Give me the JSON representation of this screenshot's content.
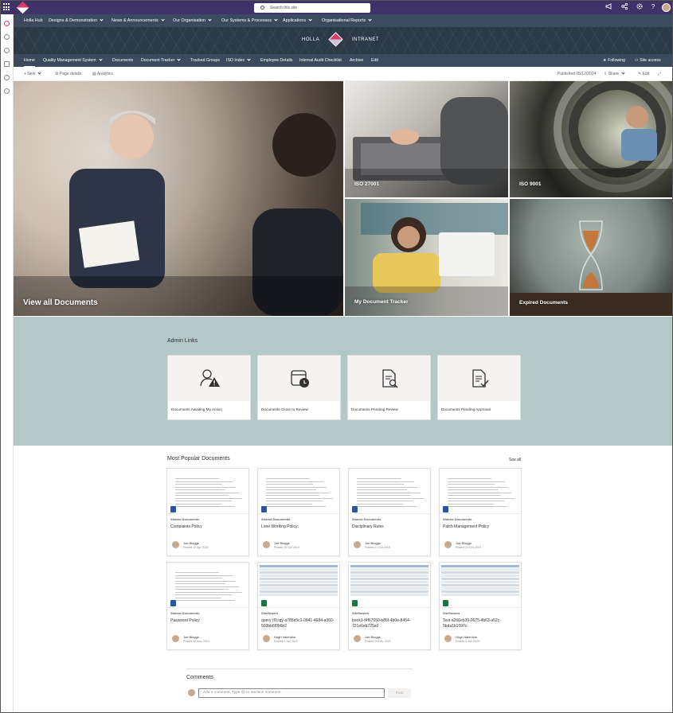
{
  "suite_bar": {
    "search_placeholder": "Search this site",
    "icons": [
      "waffle-icon",
      "megaphone-icon",
      "share-icon",
      "gear-icon",
      "help-icon"
    ]
  },
  "hub_nav": {
    "items": [
      {
        "label": "Holla Hub",
        "dropdown": false
      },
      {
        "label": "Designs & Demonstration",
        "dropdown": true
      },
      {
        "label": "News & Announcements",
        "dropdown": true
      },
      {
        "label": "Our Organisation",
        "dropdown": true
      },
      {
        "label": "Our Systems & Processes",
        "dropdown": true
      },
      {
        "label": "Applications",
        "dropdown": true
      },
      {
        "label": "Organisational Reports",
        "dropdown": true
      }
    ]
  },
  "brand": {
    "left": "HOLLA",
    "right": "INTRANET"
  },
  "site_nav": {
    "items": [
      {
        "label": "Home",
        "dropdown": false,
        "active": true
      },
      {
        "label": "Quality Management System",
        "dropdown": true,
        "active": false
      },
      {
        "label": "Documents",
        "dropdown": false,
        "active": false
      },
      {
        "label": "Document Tracker",
        "dropdown": true,
        "active": false
      },
      {
        "label": "Tracked Groups",
        "dropdown": false,
        "active": false
      },
      {
        "label": "ISO Index",
        "dropdown": true,
        "active": false
      },
      {
        "label": "Employee Details",
        "dropdown": false,
        "active": false
      },
      {
        "label": "Internal Audit Checklist",
        "dropdown": false,
        "active": false
      },
      {
        "label": "Archive",
        "dropdown": false,
        "active": false
      },
      {
        "label": "Edit",
        "dropdown": false,
        "active": false
      }
    ],
    "following": "Following",
    "site_access": "Site access"
  },
  "command_bar": {
    "new": "New",
    "page_details": "Page details",
    "analytics": "Analytics",
    "published": "Published 05/12/2024",
    "share": "Share",
    "edit": "Edit"
  },
  "hero": {
    "tiles": [
      {
        "label": "View all Documents"
      },
      {
        "label": "ISO 27001"
      },
      {
        "label": "ISO 9001"
      },
      {
        "label": "My Document Tracker"
      },
      {
        "label": "Expired Documents"
      }
    ]
  },
  "admin_links": {
    "title": "Admin Links",
    "cards": [
      {
        "label": "Documents Awaiting My Action",
        "icon": "user-warning-icon"
      },
      {
        "label": "Documents Close to Review",
        "icon": "calendar-clock-icon"
      },
      {
        "label": "Documents Pending Review",
        "icon": "document-search-icon"
      },
      {
        "label": "Documents Pending Approval",
        "icon": "document-check-icon"
      }
    ]
  },
  "popular_docs": {
    "title": "Most Popular Documents",
    "see_all": "See all",
    "docs": [
      {
        "library": "Shared Documents",
        "title": "Complaints Policy",
        "user": "Joe Bloggs",
        "date": "Posted 19 Apr 2024",
        "type": "word"
      },
      {
        "library": "Shared Documents",
        "title": "Lone Working Policy",
        "user": "Joe Bloggs",
        "date": "Posted 15 Oct 2019",
        "type": "word"
      },
      {
        "library": "Shared Documents",
        "title": "Disciplinary Rules",
        "user": "Joe Bloggs",
        "date": "Posted 21 Oct 2019",
        "type": "word"
      },
      {
        "library": "Shared Documents",
        "title": "Patch Management Policy",
        "user": "Joe Bloggs",
        "date": "Posted 24 Oct 2019",
        "type": "word"
      },
      {
        "library": "Shared Documents",
        "title": "Password Policy",
        "user": "Joe Bloggs",
        "date": "Posted 19 Nov 2019",
        "type": "word"
      },
      {
        "library": "Siteflowers",
        "title": "query (6).iqy-a785e5c1-0841-4684-a060-503bb6f0b6b2",
        "user": "Hugh Valentine",
        "date": "Posted 4 Jan 2023",
        "type": "excel"
      },
      {
        "library": "Siteflowers",
        "title": "book1-f4f67650-b86f-4b0e-8454-721e6eb725a0",
        "user": "Joe Bloggs",
        "date": "Posted 29 Dec 2021",
        "type": "excel"
      },
      {
        "library": "Siteflowers",
        "title": "Test-a266eb39-0675-4b63-a52c-5bda1b1097c",
        "user": "Hugh Valentine",
        "date": "Posted 4 Jan 2023",
        "type": "excel"
      }
    ]
  },
  "comments": {
    "title": "Comments",
    "placeholder": "Add a comment. Type @ to mention someone",
    "post": "Post"
  },
  "colors": {
    "suite_bar": "#3f3268",
    "nav_bar": "#3b4a5c",
    "admin_band": "#b5c8c8",
    "word": "#2b579a",
    "excel": "#217346"
  }
}
